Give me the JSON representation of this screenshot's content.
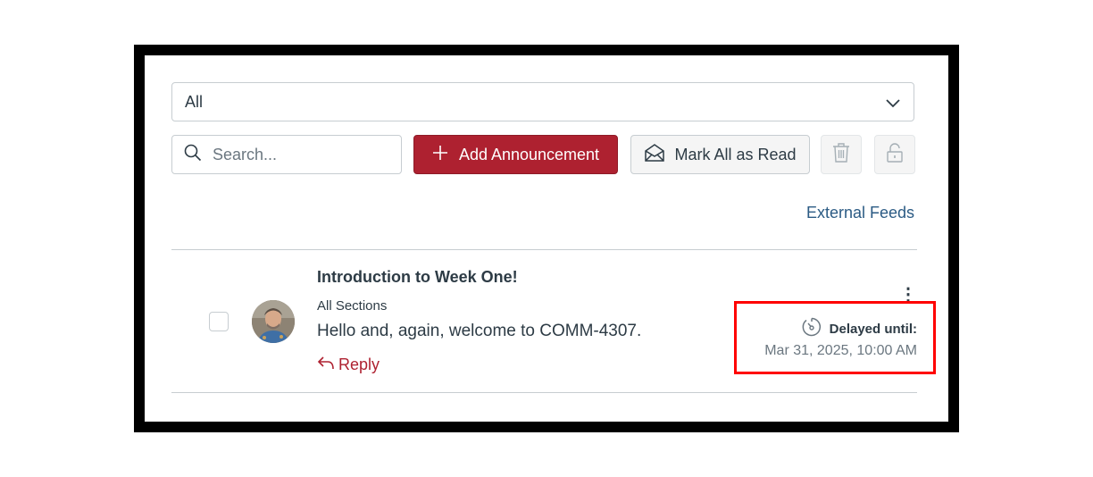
{
  "filter": {
    "selected": "All"
  },
  "search": {
    "placeholder": "Search..."
  },
  "toolbar": {
    "add_label": "Add Announcement",
    "mark_read_label": "Mark All as Read"
  },
  "external_feeds_label": "External Feeds",
  "announcement": {
    "title": "Introduction to Week One!",
    "sections": "All Sections",
    "message": "Hello and, again, welcome to COMM-4307.",
    "reply_label": "Reply",
    "menu_label": "⋮",
    "delayed_label": "Delayed until:",
    "delayed_date": "Mar 31, 2025, 10:00 AM"
  },
  "colors": {
    "brand": "#ae2130",
    "link": "#2b5b84",
    "highlight": "#ff0000"
  },
  "icons": [
    "chevron-down-icon",
    "search-icon",
    "plus-icon",
    "envelope-open-icon",
    "trash-icon",
    "unlock-icon",
    "reply-icon",
    "clock-delay-icon"
  ]
}
